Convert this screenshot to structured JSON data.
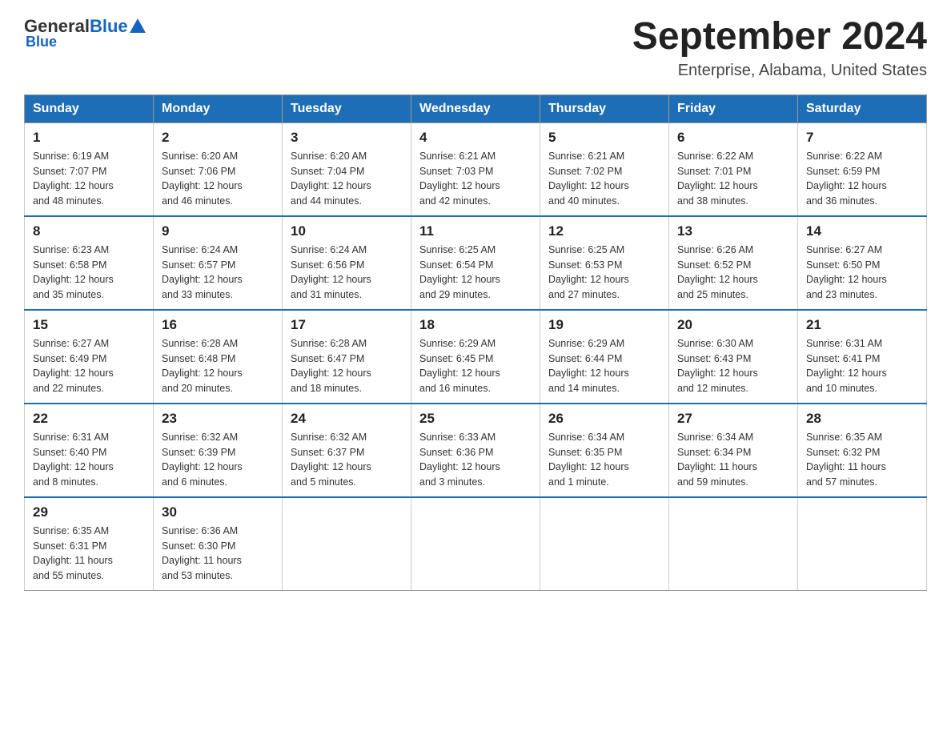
{
  "header": {
    "logo_general": "General",
    "logo_blue": "Blue",
    "title": "September 2024",
    "location": "Enterprise, Alabama, United States"
  },
  "days_of_week": [
    "Sunday",
    "Monday",
    "Tuesday",
    "Wednesday",
    "Thursday",
    "Friday",
    "Saturday"
  ],
  "weeks": [
    [
      {
        "day": "1",
        "sunrise": "6:19 AM",
        "sunset": "7:07 PM",
        "daylight": "12 hours and 48 minutes."
      },
      {
        "day": "2",
        "sunrise": "6:20 AM",
        "sunset": "7:06 PM",
        "daylight": "12 hours and 46 minutes."
      },
      {
        "day": "3",
        "sunrise": "6:20 AM",
        "sunset": "7:04 PM",
        "daylight": "12 hours and 44 minutes."
      },
      {
        "day": "4",
        "sunrise": "6:21 AM",
        "sunset": "7:03 PM",
        "daylight": "12 hours and 42 minutes."
      },
      {
        "day": "5",
        "sunrise": "6:21 AM",
        "sunset": "7:02 PM",
        "daylight": "12 hours and 40 minutes."
      },
      {
        "day": "6",
        "sunrise": "6:22 AM",
        "sunset": "7:01 PM",
        "daylight": "12 hours and 38 minutes."
      },
      {
        "day": "7",
        "sunrise": "6:22 AM",
        "sunset": "6:59 PM",
        "daylight": "12 hours and 36 minutes."
      }
    ],
    [
      {
        "day": "8",
        "sunrise": "6:23 AM",
        "sunset": "6:58 PM",
        "daylight": "12 hours and 35 minutes."
      },
      {
        "day": "9",
        "sunrise": "6:24 AM",
        "sunset": "6:57 PM",
        "daylight": "12 hours and 33 minutes."
      },
      {
        "day": "10",
        "sunrise": "6:24 AM",
        "sunset": "6:56 PM",
        "daylight": "12 hours and 31 minutes."
      },
      {
        "day": "11",
        "sunrise": "6:25 AM",
        "sunset": "6:54 PM",
        "daylight": "12 hours and 29 minutes."
      },
      {
        "day": "12",
        "sunrise": "6:25 AM",
        "sunset": "6:53 PM",
        "daylight": "12 hours and 27 minutes."
      },
      {
        "day": "13",
        "sunrise": "6:26 AM",
        "sunset": "6:52 PM",
        "daylight": "12 hours and 25 minutes."
      },
      {
        "day": "14",
        "sunrise": "6:27 AM",
        "sunset": "6:50 PM",
        "daylight": "12 hours and 23 minutes."
      }
    ],
    [
      {
        "day": "15",
        "sunrise": "6:27 AM",
        "sunset": "6:49 PM",
        "daylight": "12 hours and 22 minutes."
      },
      {
        "day": "16",
        "sunrise": "6:28 AM",
        "sunset": "6:48 PM",
        "daylight": "12 hours and 20 minutes."
      },
      {
        "day": "17",
        "sunrise": "6:28 AM",
        "sunset": "6:47 PM",
        "daylight": "12 hours and 18 minutes."
      },
      {
        "day": "18",
        "sunrise": "6:29 AM",
        "sunset": "6:45 PM",
        "daylight": "12 hours and 16 minutes."
      },
      {
        "day": "19",
        "sunrise": "6:29 AM",
        "sunset": "6:44 PM",
        "daylight": "12 hours and 14 minutes."
      },
      {
        "day": "20",
        "sunrise": "6:30 AM",
        "sunset": "6:43 PM",
        "daylight": "12 hours and 12 minutes."
      },
      {
        "day": "21",
        "sunrise": "6:31 AM",
        "sunset": "6:41 PM",
        "daylight": "12 hours and 10 minutes."
      }
    ],
    [
      {
        "day": "22",
        "sunrise": "6:31 AM",
        "sunset": "6:40 PM",
        "daylight": "12 hours and 8 minutes."
      },
      {
        "day": "23",
        "sunrise": "6:32 AM",
        "sunset": "6:39 PM",
        "daylight": "12 hours and 6 minutes."
      },
      {
        "day": "24",
        "sunrise": "6:32 AM",
        "sunset": "6:37 PM",
        "daylight": "12 hours and 5 minutes."
      },
      {
        "day": "25",
        "sunrise": "6:33 AM",
        "sunset": "6:36 PM",
        "daylight": "12 hours and 3 minutes."
      },
      {
        "day": "26",
        "sunrise": "6:34 AM",
        "sunset": "6:35 PM",
        "daylight": "12 hours and 1 minute."
      },
      {
        "day": "27",
        "sunrise": "6:34 AM",
        "sunset": "6:34 PM",
        "daylight": "11 hours and 59 minutes."
      },
      {
        "day": "28",
        "sunrise": "6:35 AM",
        "sunset": "6:32 PM",
        "daylight": "11 hours and 57 minutes."
      }
    ],
    [
      {
        "day": "29",
        "sunrise": "6:35 AM",
        "sunset": "6:31 PM",
        "daylight": "11 hours and 55 minutes."
      },
      {
        "day": "30",
        "sunrise": "6:36 AM",
        "sunset": "6:30 PM",
        "daylight": "11 hours and 53 minutes."
      },
      null,
      null,
      null,
      null,
      null
    ]
  ],
  "labels": {
    "sunrise": "Sunrise:",
    "sunset": "Sunset:",
    "daylight": "Daylight:"
  }
}
